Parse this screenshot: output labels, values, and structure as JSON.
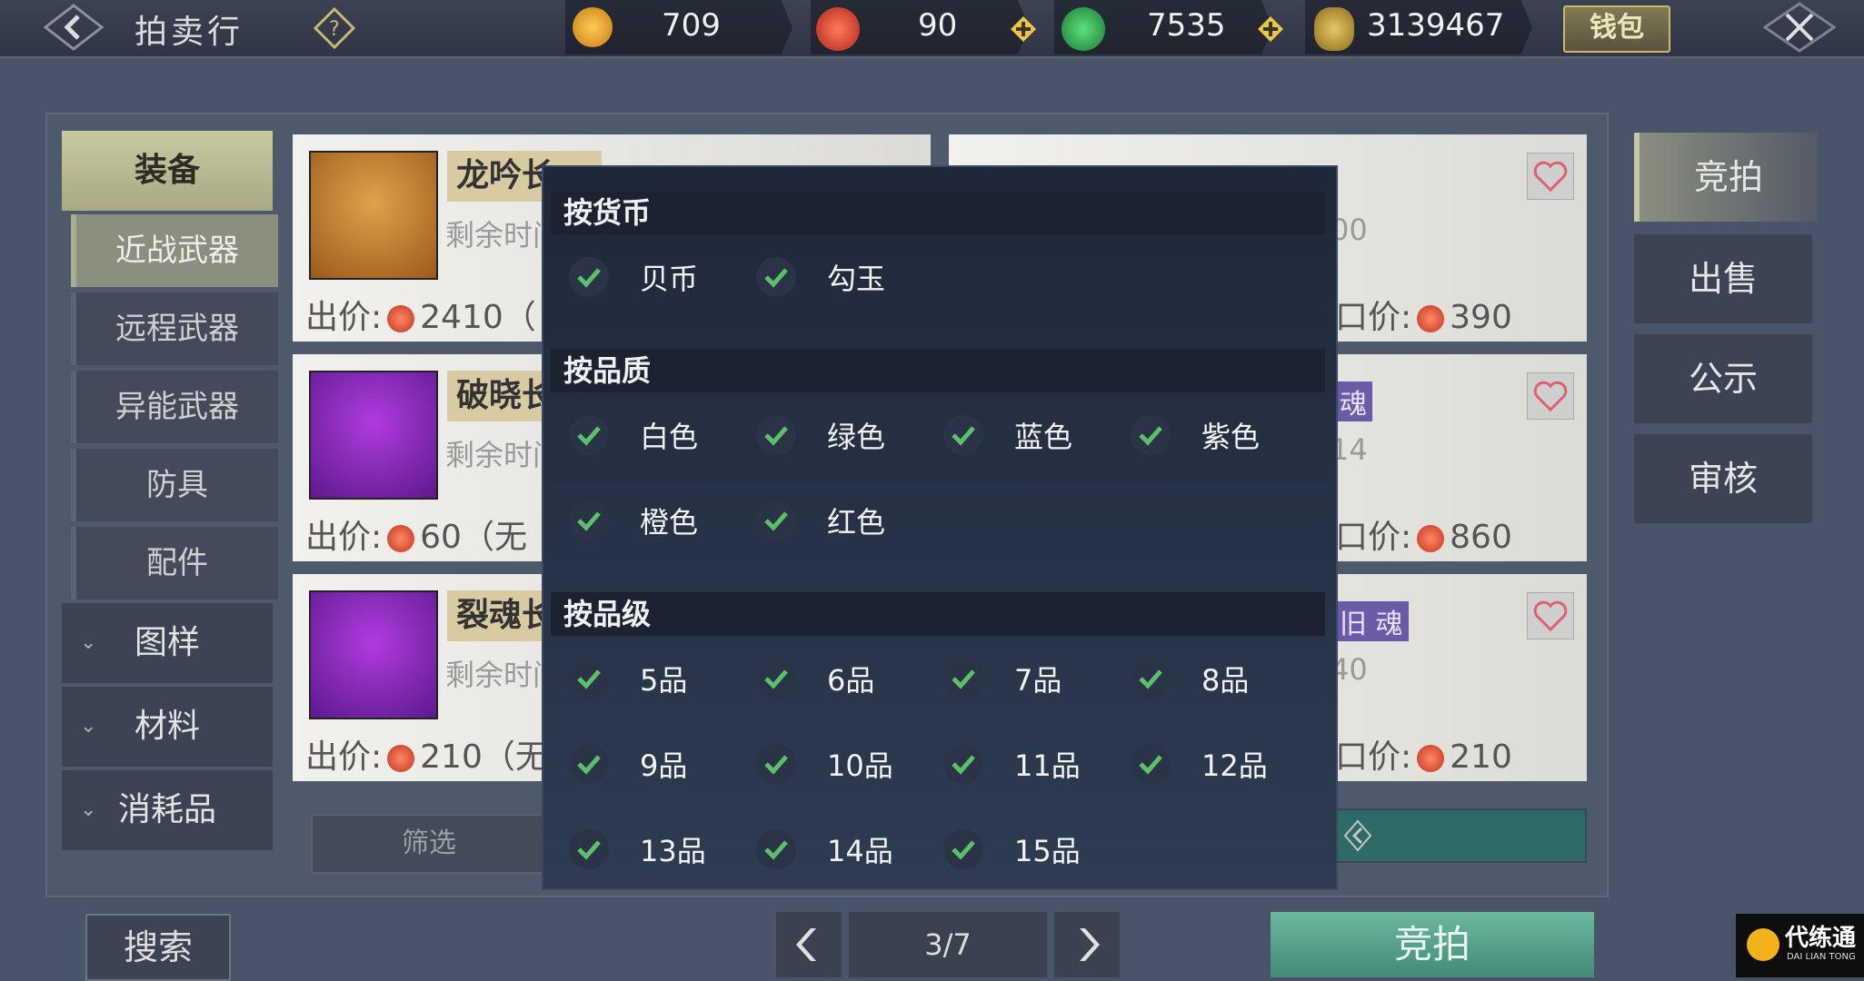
{
  "header": {
    "title": "拍卖行",
    "currencies": [
      {
        "icon": "gold-coin-icon",
        "value": "709"
      },
      {
        "icon": "red-swirl-coin-icon",
        "value": "90"
      },
      {
        "icon": "green-jade-icon",
        "value": "7535"
      },
      {
        "icon": "shell-coin-icon",
        "value": "3139467"
      }
    ],
    "wallet_label": "钱包"
  },
  "nav": {
    "categories": [
      {
        "label": "装备"
      },
      {
        "label": "图样"
      },
      {
        "label": "材料"
      },
      {
        "label": "消耗品"
      }
    ],
    "subs": [
      {
        "label": "近战武器"
      },
      {
        "label": "远程武器"
      },
      {
        "label": "异能武器"
      },
      {
        "label": "防具"
      },
      {
        "label": "配件"
      }
    ]
  },
  "cards_left": [
    {
      "name": "龙吟长",
      "remain": "剩余时间",
      "price_label": "出价:",
      "price": "2410（",
      "thumb": "orange"
    },
    {
      "name": "破晓长",
      "remain": "剩余时间",
      "price_label": "出价:",
      "price": "60（无",
      "thumb": "purple"
    },
    {
      "name": "裂魂长",
      "remain": "剩余时间",
      "price_label": "出价:",
      "price": "210（无",
      "thumb": "purple"
    }
  ],
  "cards_right": [
    {
      "remain": "00",
      "price_label": "口价:",
      "price": "390",
      "tag": ""
    },
    {
      "remain": "14",
      "price_label": "口价:",
      "price": "860",
      "tag": "魂"
    },
    {
      "remain": "40",
      "price_label": "口价:",
      "price": "210",
      "tag": "旧 魂"
    }
  ],
  "side_tabs": [
    {
      "label": "竞拍"
    },
    {
      "label": "出售"
    },
    {
      "label": "公示"
    },
    {
      "label": "审核"
    }
  ],
  "bottom": {
    "filter_label": "筛选",
    "search_label": "搜索",
    "page": "3/7",
    "bid_label": "竞拍"
  },
  "popup": {
    "sections": [
      {
        "title": "按货币",
        "options": [
          "贝币",
          "勾玉"
        ]
      },
      {
        "title": "按品质",
        "options": [
          "白色",
          "绿色",
          "蓝色",
          "紫色",
          "橙色",
          "红色"
        ]
      },
      {
        "title": "按品级",
        "options": [
          "5品",
          "6品",
          "7品",
          "8品",
          "9品",
          "10品",
          "11品",
          "12品",
          "13品",
          "14品",
          "15品"
        ]
      }
    ]
  },
  "logo": {
    "text": "代练通",
    "subtext": "DAI LIAN TONG"
  },
  "colors": {
    "check": "#5cc06a",
    "accent_teal": "#4a9a86"
  }
}
